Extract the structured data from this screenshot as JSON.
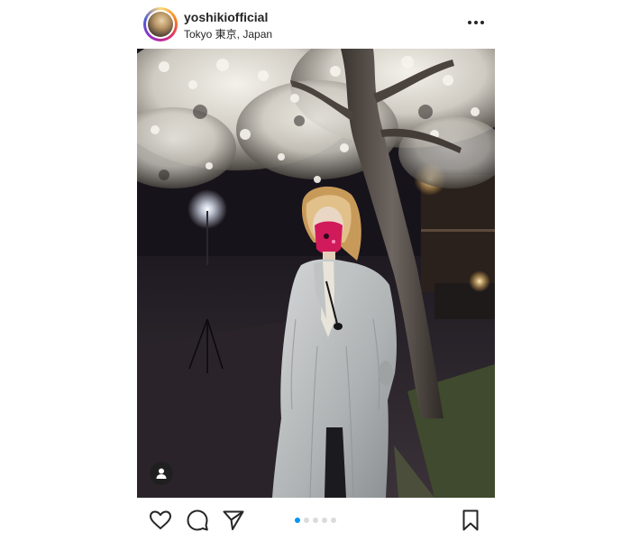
{
  "post": {
    "username": "yoshikiofficial",
    "location": "Tokyo 東京, Japan"
  },
  "icons": {
    "more": "more-options-icon",
    "tag": "user-tag-icon",
    "like": "heart-icon",
    "comment": "comment-icon",
    "share": "send-icon",
    "save": "bookmark-icon"
  },
  "carousel": {
    "total_slides": 5,
    "active_slide": 1
  },
  "colors": {
    "text": "#262626",
    "active_dot": "#0095f6",
    "inactive_dot": "#dbdbdb"
  }
}
